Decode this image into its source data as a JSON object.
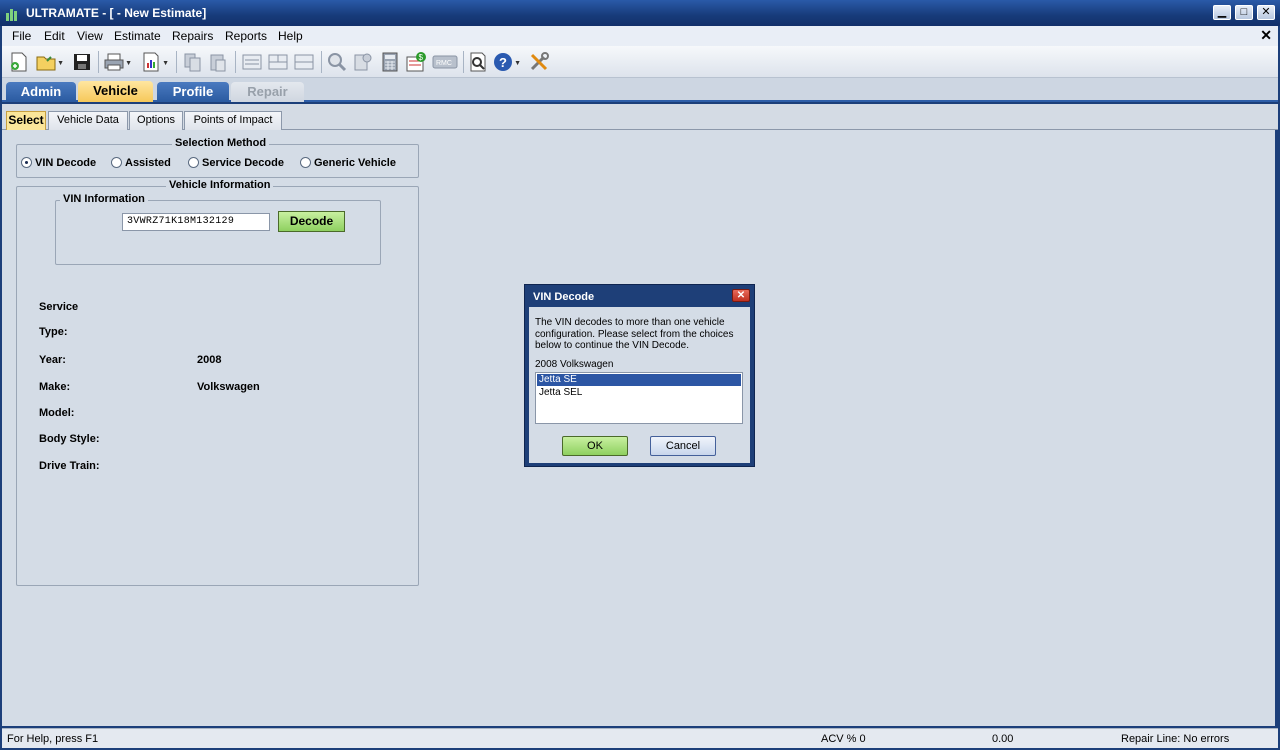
{
  "window": {
    "title": "ULTRAMATE - [ - New Estimate]",
    "minimize": "▁",
    "maximize": "□",
    "close": "✕"
  },
  "menu": {
    "items": [
      {
        "label": "File"
      },
      {
        "label": "Edit"
      },
      {
        "label": "View"
      },
      {
        "label": "Estimate"
      },
      {
        "label": "Repairs"
      },
      {
        "label": "Reports"
      },
      {
        "label": "Help"
      }
    ],
    "mdi_close": "✕"
  },
  "toolbar": {
    "icons": [
      "new-icon",
      "open-icon",
      "save-icon",
      "print-icon",
      "report-icon",
      "copy-icon",
      "paste-icon",
      "layout1-icon",
      "layout2-icon",
      "layout3-icon",
      "search-icon",
      "lookup-icon",
      "calculator-icon",
      "totals-icon",
      "rmc-icon",
      "preview-icon",
      "help-icon",
      "tools-icon"
    ],
    "rmc_label": "RMC"
  },
  "module_tabs": [
    {
      "label": "Admin",
      "state": "normal"
    },
    {
      "label": "Vehicle",
      "state": "active"
    },
    {
      "label": "Profile",
      "state": "normal"
    },
    {
      "label": "Repair",
      "state": "disabled"
    }
  ],
  "sub_tabs": [
    {
      "label": "Select",
      "active": true
    },
    {
      "label": "Vehicle Data"
    },
    {
      "label": "Options"
    },
    {
      "label": "Points of Impact"
    }
  ],
  "selection_method": {
    "legend": "Selection Method",
    "options": [
      {
        "label": "VIN Decode",
        "selected": true
      },
      {
        "label": "Assisted"
      },
      {
        "label": "Service Decode"
      },
      {
        "label": "Generic Vehicle"
      }
    ]
  },
  "vehicle_info": {
    "legend": "Vehicle Information",
    "vin_legend": "VIN Information",
    "vin_value": "3VWRZ71K18M132129",
    "decode_label": "Decode",
    "fields": [
      {
        "label": "Service",
        "value": ""
      },
      {
        "label": "Type:",
        "value": ""
      },
      {
        "label": "Year:",
        "value": "2008"
      },
      {
        "label": "Make:",
        "value": "Volkswagen"
      },
      {
        "label": "Model:",
        "value": ""
      },
      {
        "label": "Body Style:",
        "value": ""
      },
      {
        "label": "Drive Train:",
        "value": ""
      }
    ]
  },
  "dialog": {
    "title": "VIN Decode",
    "message": "The VIN decodes to more than one vehicle configuration. Please select from the choices below to continue the VIN Decode.",
    "subtitle": "2008 Volkswagen",
    "options": [
      {
        "label": "Jetta SE",
        "selected": true
      },
      {
        "label": "Jetta SEL"
      }
    ],
    "ok_label": "OK",
    "cancel_label": "Cancel"
  },
  "status": {
    "help": "For Help, press F1",
    "acv": "ACV % 0",
    "amount": "0.00",
    "repair_line": "Repair Line: No errors"
  }
}
